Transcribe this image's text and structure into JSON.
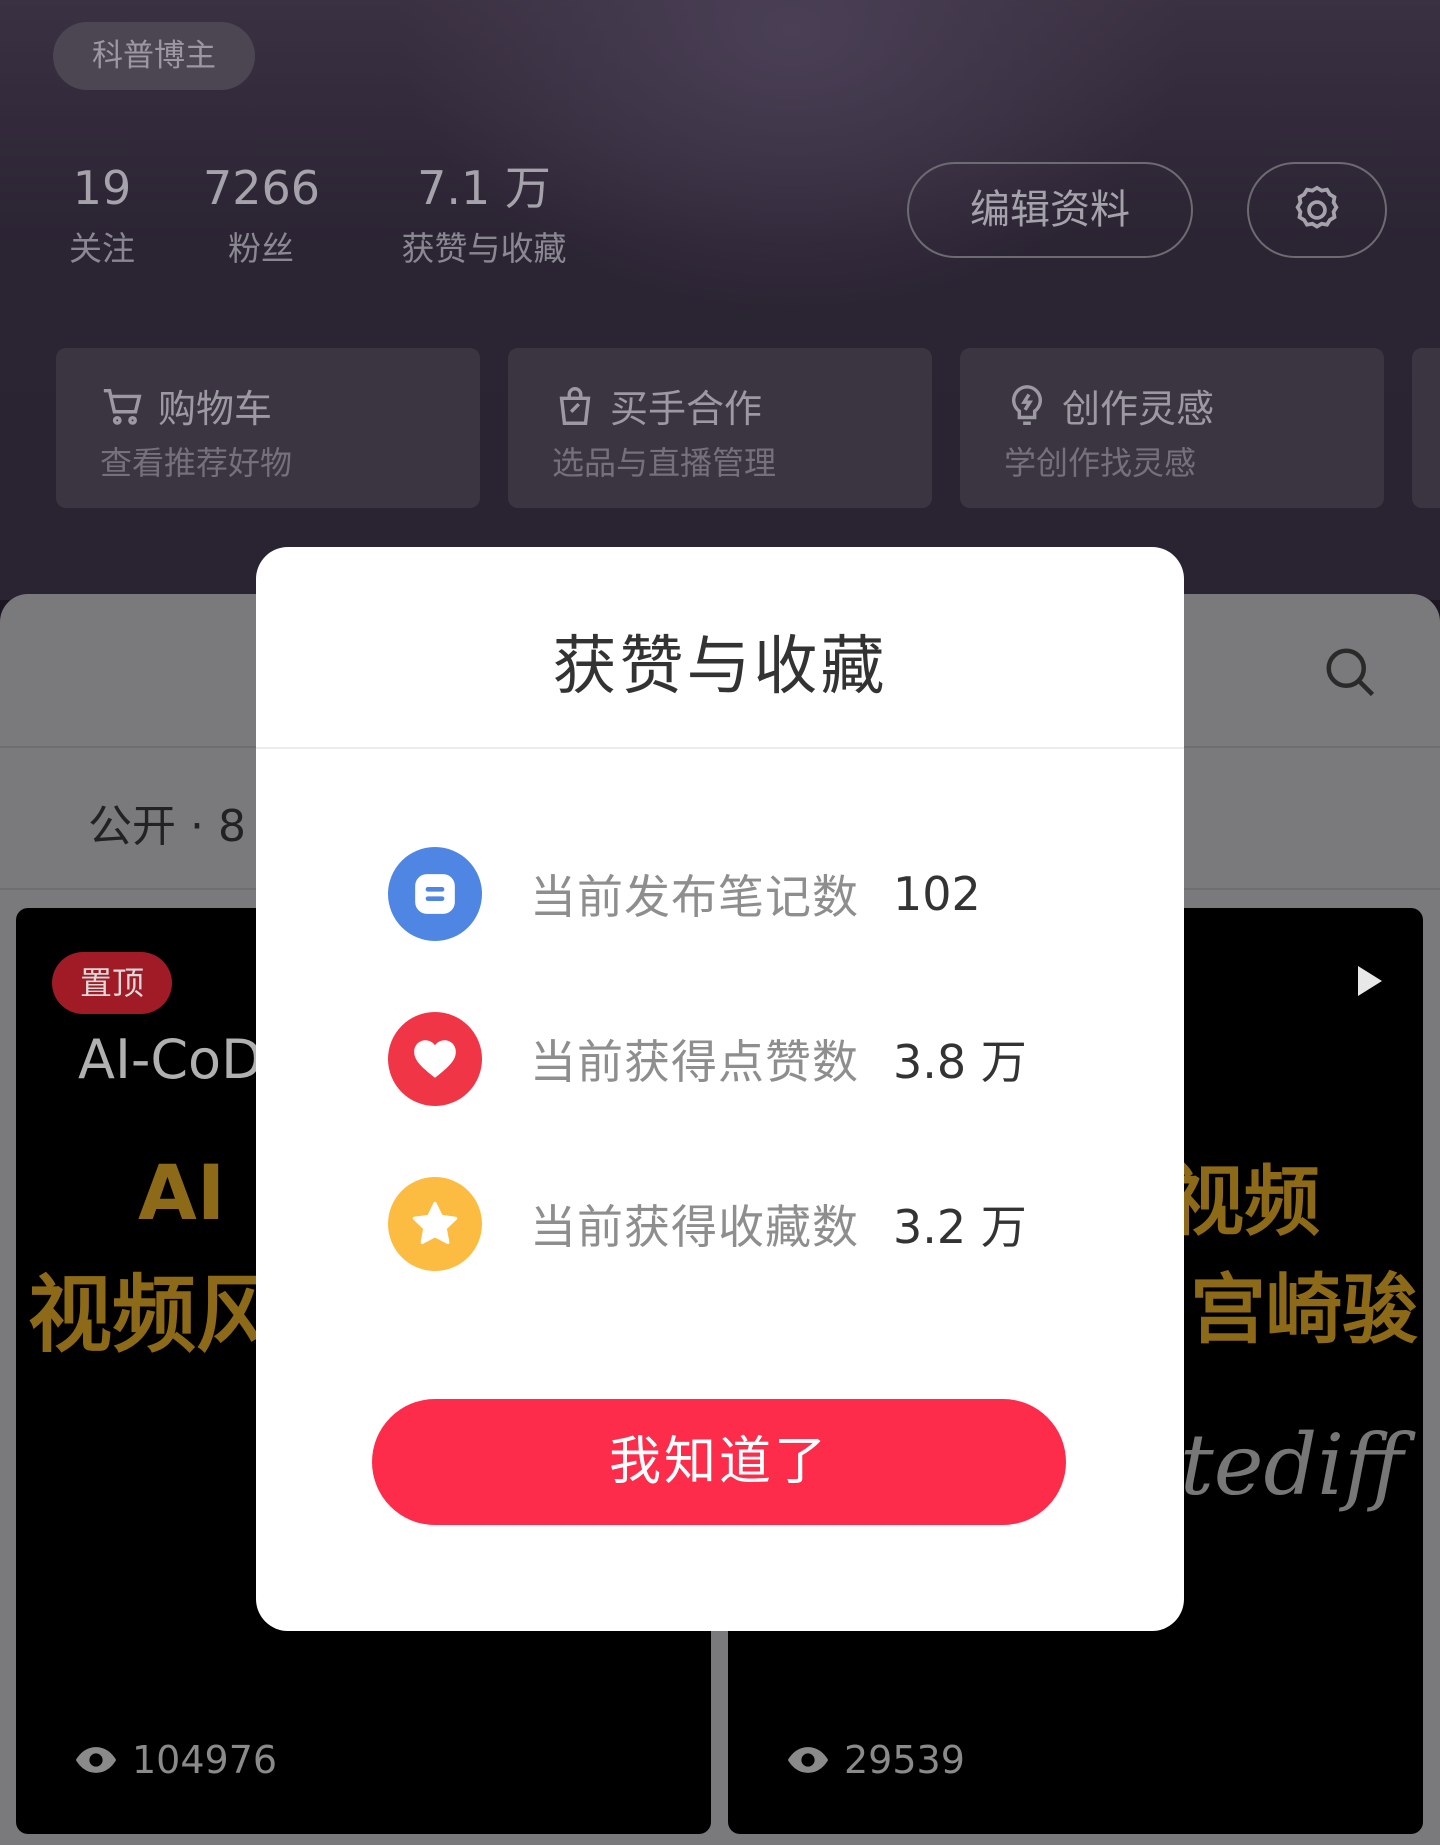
{
  "profile": {
    "tag": "科普博主",
    "stats": [
      {
        "value": "19",
        "label": "关注"
      },
      {
        "value": "7266",
        "label": "粉丝"
      },
      {
        "value": "7.1 万",
        "label": "获赞与收藏"
      }
    ],
    "edit_label": "编辑资料",
    "settings_icon": "gear-icon"
  },
  "cards": [
    {
      "title": "购物车",
      "subtitle": "查看推荐好物",
      "icon": "cart-icon"
    },
    {
      "title": "买手合作",
      "subtitle": "选品与直播管理",
      "icon": "shopping-bag-icon"
    },
    {
      "title": "创作灵感",
      "subtitle": "学创作找灵感",
      "icon": "bulb-icon"
    }
  ],
  "notes": {
    "public_label": "公开 · 8",
    "search_icon": "search-icon",
    "items": [
      {
        "badge": "置顶",
        "title_en": "AI-CoD",
        "line1": "AI",
        "line2": "视频风",
        "views": "104976"
      },
      {
        "line1": "视频",
        "line2": "宫崎骏",
        "script_text": "tediff",
        "views": "29539"
      }
    ]
  },
  "modal": {
    "title": "获赞与收藏",
    "rows": [
      {
        "label": "当前发布笔记数",
        "value": "102",
        "icon": "note-icon",
        "color": "#4f86e3"
      },
      {
        "label": "当前获得点赞数",
        "value": "3.8 万",
        "icon": "heart-icon",
        "color": "#f03547"
      },
      {
        "label": "当前获得收藏数",
        "value": "3.2 万",
        "icon": "star-icon",
        "color": "#fbbc41"
      }
    ],
    "ok_label": "我知道了",
    "ok_color": "#fe2c4b"
  }
}
